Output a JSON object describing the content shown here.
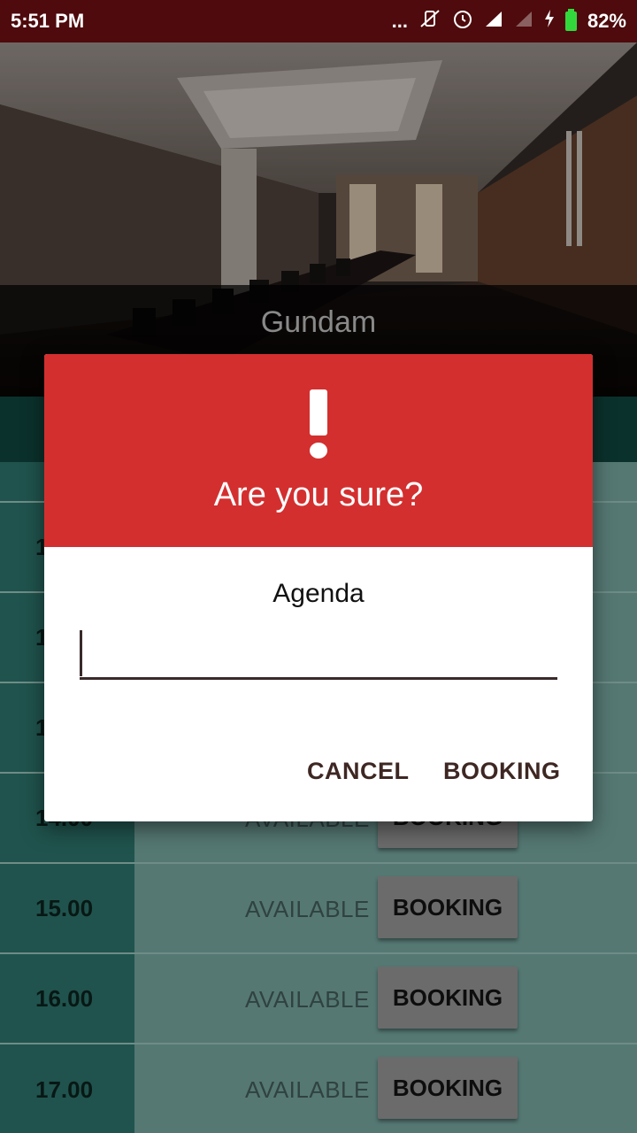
{
  "status_bar": {
    "time": "5:51 PM",
    "battery": "82%",
    "dots": "...",
    "icons": [
      "vibrate-off-icon",
      "alarm-icon",
      "signal-icon",
      "signal-empty-icon",
      "charging-icon",
      "battery-icon"
    ]
  },
  "room": {
    "name": "Gundam"
  },
  "colors": {
    "accent": "#d32f2f",
    "status_bar": "#4e0a0c",
    "teal_dark": "#0f3f39",
    "time_col": "#2a6b63"
  },
  "rows": [
    {
      "time": "",
      "status": "",
      "button": ""
    },
    {
      "time": "1",
      "status": "",
      "button": ""
    },
    {
      "time": "1",
      "status": "",
      "button": ""
    },
    {
      "time": "1",
      "status": "",
      "button": ""
    },
    {
      "time": "14.00",
      "status": "AVAILABLE",
      "button": "BOOKING"
    },
    {
      "time": "15.00",
      "status": "AVAILABLE",
      "button": "BOOKING"
    },
    {
      "time": "16.00",
      "status": "AVAILABLE",
      "button": "BOOKING"
    },
    {
      "time": "17.00",
      "status": "AVAILABLE",
      "button": "BOOKING"
    }
  ],
  "dialog": {
    "icon": "exclamation-icon",
    "title": "Are you sure?",
    "field_label": "Agenda",
    "field_value": "",
    "cancel_label": "CANCEL",
    "confirm_label": "BOOKING"
  }
}
